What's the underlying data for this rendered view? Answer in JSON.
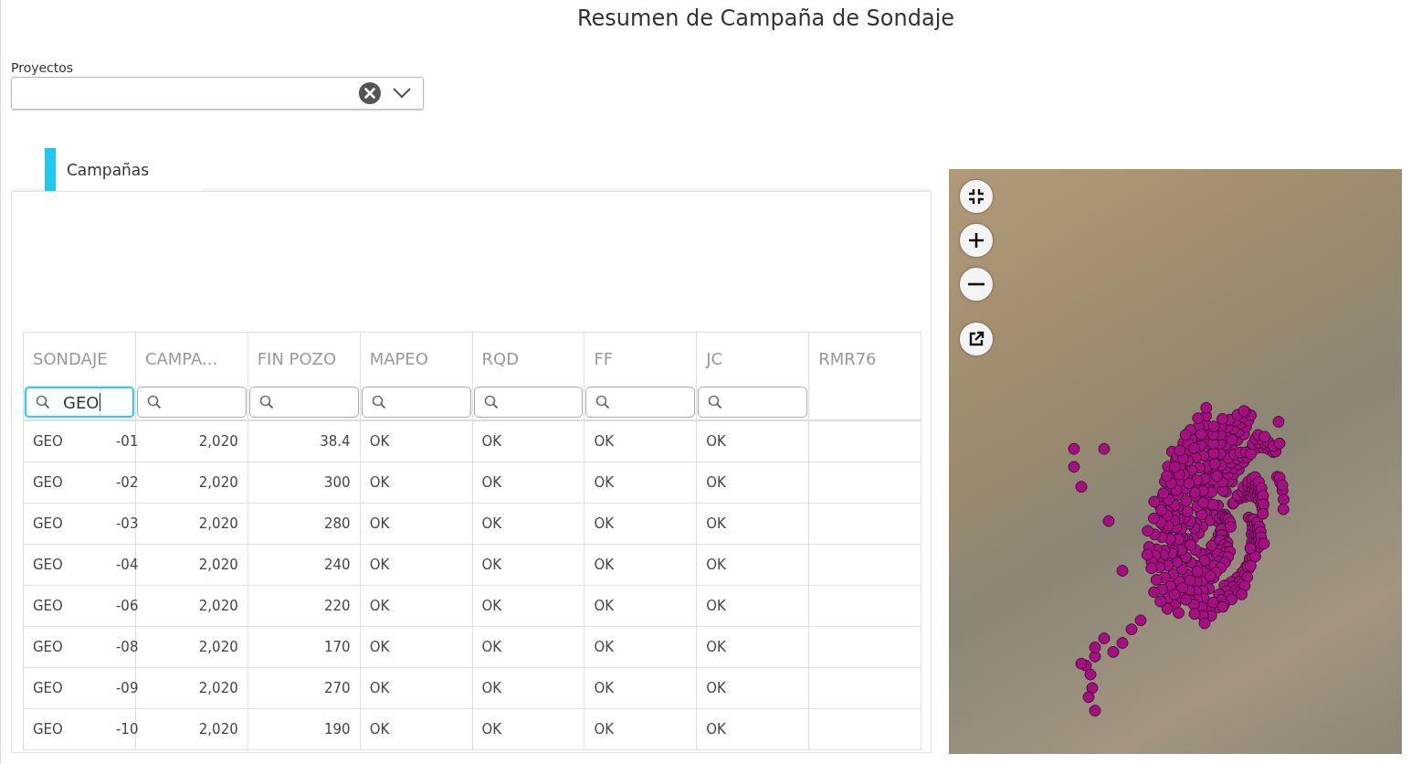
{
  "title": "Resumen de Campaña de Sondaje",
  "projects": {
    "label": "Proyectos"
  },
  "tabs": [
    {
      "label": "Campañas",
      "selected": true
    }
  ],
  "table": {
    "columns": [
      {
        "label": "SONDAJE",
        "filter": true,
        "value": "GEO"
      },
      {
        "label": "CAMPA...",
        "filter": true
      },
      {
        "label": "FIN POZO",
        "filter": true
      },
      {
        "label": "MAPEO",
        "filter": true
      },
      {
        "label": "RQD",
        "filter": true
      },
      {
        "label": "FF",
        "filter": true
      },
      {
        "label": "JC",
        "filter": true
      },
      {
        "label": "RMR76",
        "filter": false
      }
    ],
    "rows": [
      {
        "sondaje": [
          "GEO",
          "-01"
        ],
        "campana": "2,020",
        "fin_pozo": "38.4",
        "mapeo": "OK",
        "rqd": "OK",
        "ff": "OK",
        "jc": "OK"
      },
      {
        "sondaje": [
          "GEO",
          "-02"
        ],
        "campana": "2,020",
        "fin_pozo": "300",
        "mapeo": "OK",
        "rqd": "OK",
        "ff": "OK",
        "jc": "OK"
      },
      {
        "sondaje": [
          "GEO",
          "-03"
        ],
        "campana": "2,020",
        "fin_pozo": "280",
        "mapeo": "OK",
        "rqd": "OK",
        "ff": "OK",
        "jc": "OK"
      },
      {
        "sondaje": [
          "GEO",
          "-04"
        ],
        "campana": "2,020",
        "fin_pozo": "240",
        "mapeo": "OK",
        "rqd": "OK",
        "ff": "OK",
        "jc": "OK"
      },
      {
        "sondaje": [
          "GEO",
          "-06"
        ],
        "campana": "2,020",
        "fin_pozo": "220",
        "mapeo": "OK",
        "rqd": "OK",
        "ff": "OK",
        "jc": "OK"
      },
      {
        "sondaje": [
          "GEO",
          "-08"
        ],
        "campana": "2,020",
        "fin_pozo": "170",
        "mapeo": "OK",
        "rqd": "OK",
        "ff": "OK",
        "jc": "OK"
      },
      {
        "sondaje": [
          "GEO",
          "-09"
        ],
        "campana": "2,020",
        "fin_pozo": "270",
        "mapeo": "OK",
        "rqd": "OK",
        "ff": "OK",
        "jc": "OK"
      },
      {
        "sondaje": [
          "GEO",
          "-10"
        ],
        "campana": "2,020",
        "fin_pozo": "190",
        "mapeo": "OK",
        "rqd": "OK",
        "ff": "OK",
        "jc": "OK"
      }
    ]
  }
}
